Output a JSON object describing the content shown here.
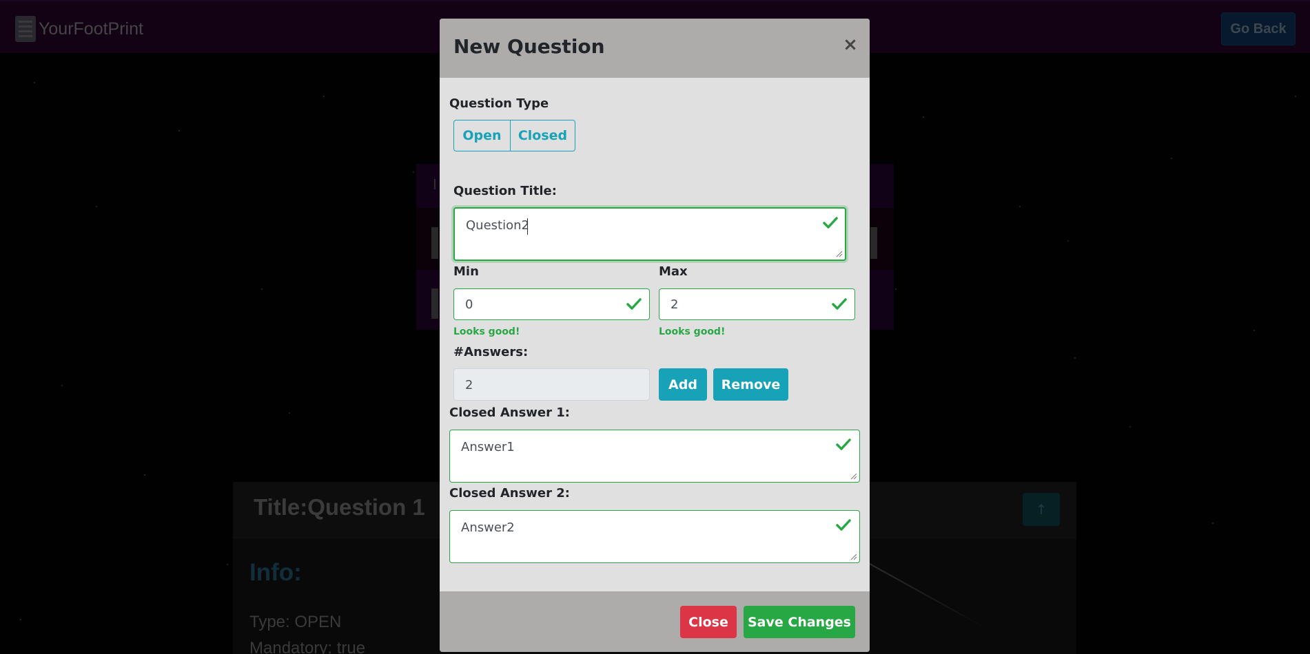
{
  "navbar": {
    "brand": "YourFootPrint",
    "go_back_label": "Go Back"
  },
  "background": {
    "panel_label": "I",
    "card": {
      "title": "Title:Question 1",
      "info_heading": "Info:",
      "type_line": "Type: OPEN",
      "mandatory_line": "Mandatory: true",
      "up_icon": "↑"
    }
  },
  "modal": {
    "title": "New Question",
    "close_icon": "×",
    "question_type": {
      "label": "Question Type",
      "options": [
        "Open",
        "Closed"
      ]
    },
    "question_title": {
      "label": "Question Title:",
      "value": "Question2"
    },
    "min": {
      "label": "Min",
      "value": "0",
      "feedback": "Looks good!"
    },
    "max": {
      "label": "Max",
      "value": "2",
      "feedback": "Looks good!"
    },
    "answers": {
      "label": "#Answers:",
      "value": "2",
      "add_label": "Add",
      "remove_label": "Remove"
    },
    "closed_answers": [
      {
        "label": "Closed Answer 1:",
        "value": "Answer1"
      },
      {
        "label": "Closed Answer 2:",
        "value": "Answer2"
      }
    ],
    "footer": {
      "close_label": "Close",
      "save_label": "Save Changes"
    }
  },
  "colors": {
    "valid": "#28a745",
    "info": "#17a2b8",
    "danger": "#dc3545",
    "modal_header": "#adacab",
    "modal_body": "#e1e0e1",
    "navbar": "#220526"
  }
}
